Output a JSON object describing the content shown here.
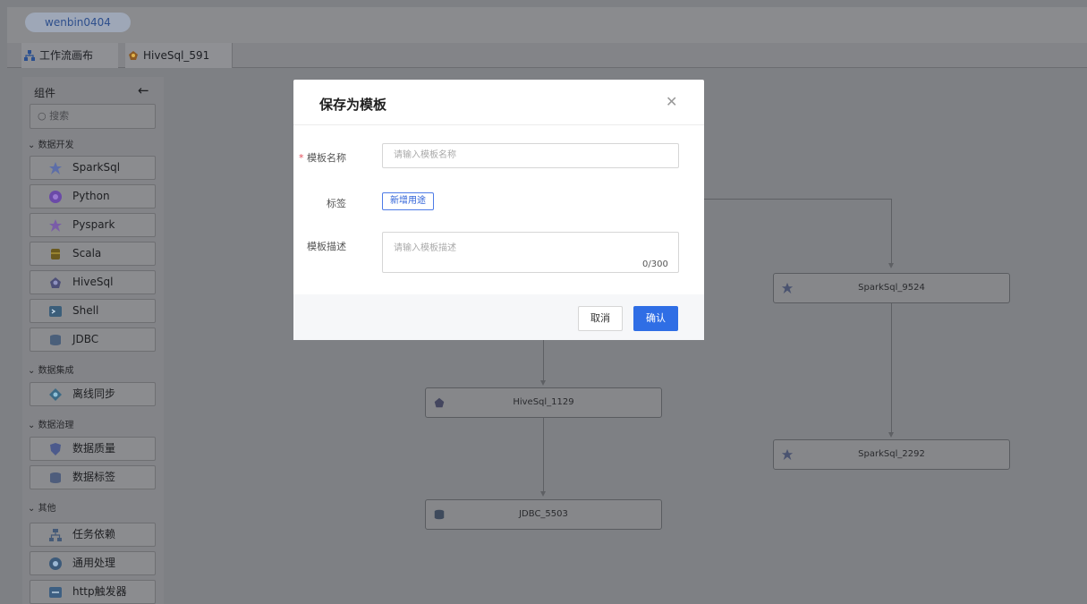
{
  "header": {
    "user": "wenbin0404"
  },
  "tabs": [
    {
      "label": "工作流画布",
      "icon": "workflow-icon"
    },
    {
      "label": "HiveSql_591",
      "icon": "hive-icon"
    }
  ],
  "sidebar": {
    "title": "组件",
    "back_icon": "arrow-left-icon",
    "search_placeholder": "搜索",
    "sections": [
      {
        "label": "数据开发",
        "items": [
          "SparkSql",
          "Python",
          "Pyspark",
          "Scala",
          "HiveSql",
          "Shell",
          "JDBC"
        ]
      },
      {
        "label": "数据集成",
        "items": [
          "离线同步"
        ]
      },
      {
        "label": "数据治理",
        "items": [
          "数据质量",
          "数据标签"
        ]
      },
      {
        "label": "其他",
        "items": [
          "任务依赖",
          "通用处理",
          "http触发器"
        ]
      }
    ]
  },
  "canvas": {
    "nodes": [
      "SparkSql_9524",
      "HiveSql_1129",
      "SparkSql_2292",
      "JDBC_5503"
    ]
  },
  "modal": {
    "title": "保存为模板",
    "name_label": "模板名称",
    "name_placeholder": "请输入模板名称",
    "tag_label": "标签",
    "tag_button": "新增用途",
    "desc_label": "模板描述",
    "desc_placeholder": "请输入模板描述",
    "desc_count": "0/300",
    "cancel": "取消",
    "confirm": "确认"
  },
  "colors": {
    "primary": "#2f6ee5",
    "required": "#e34d59",
    "overlay": "#7e8084"
  }
}
